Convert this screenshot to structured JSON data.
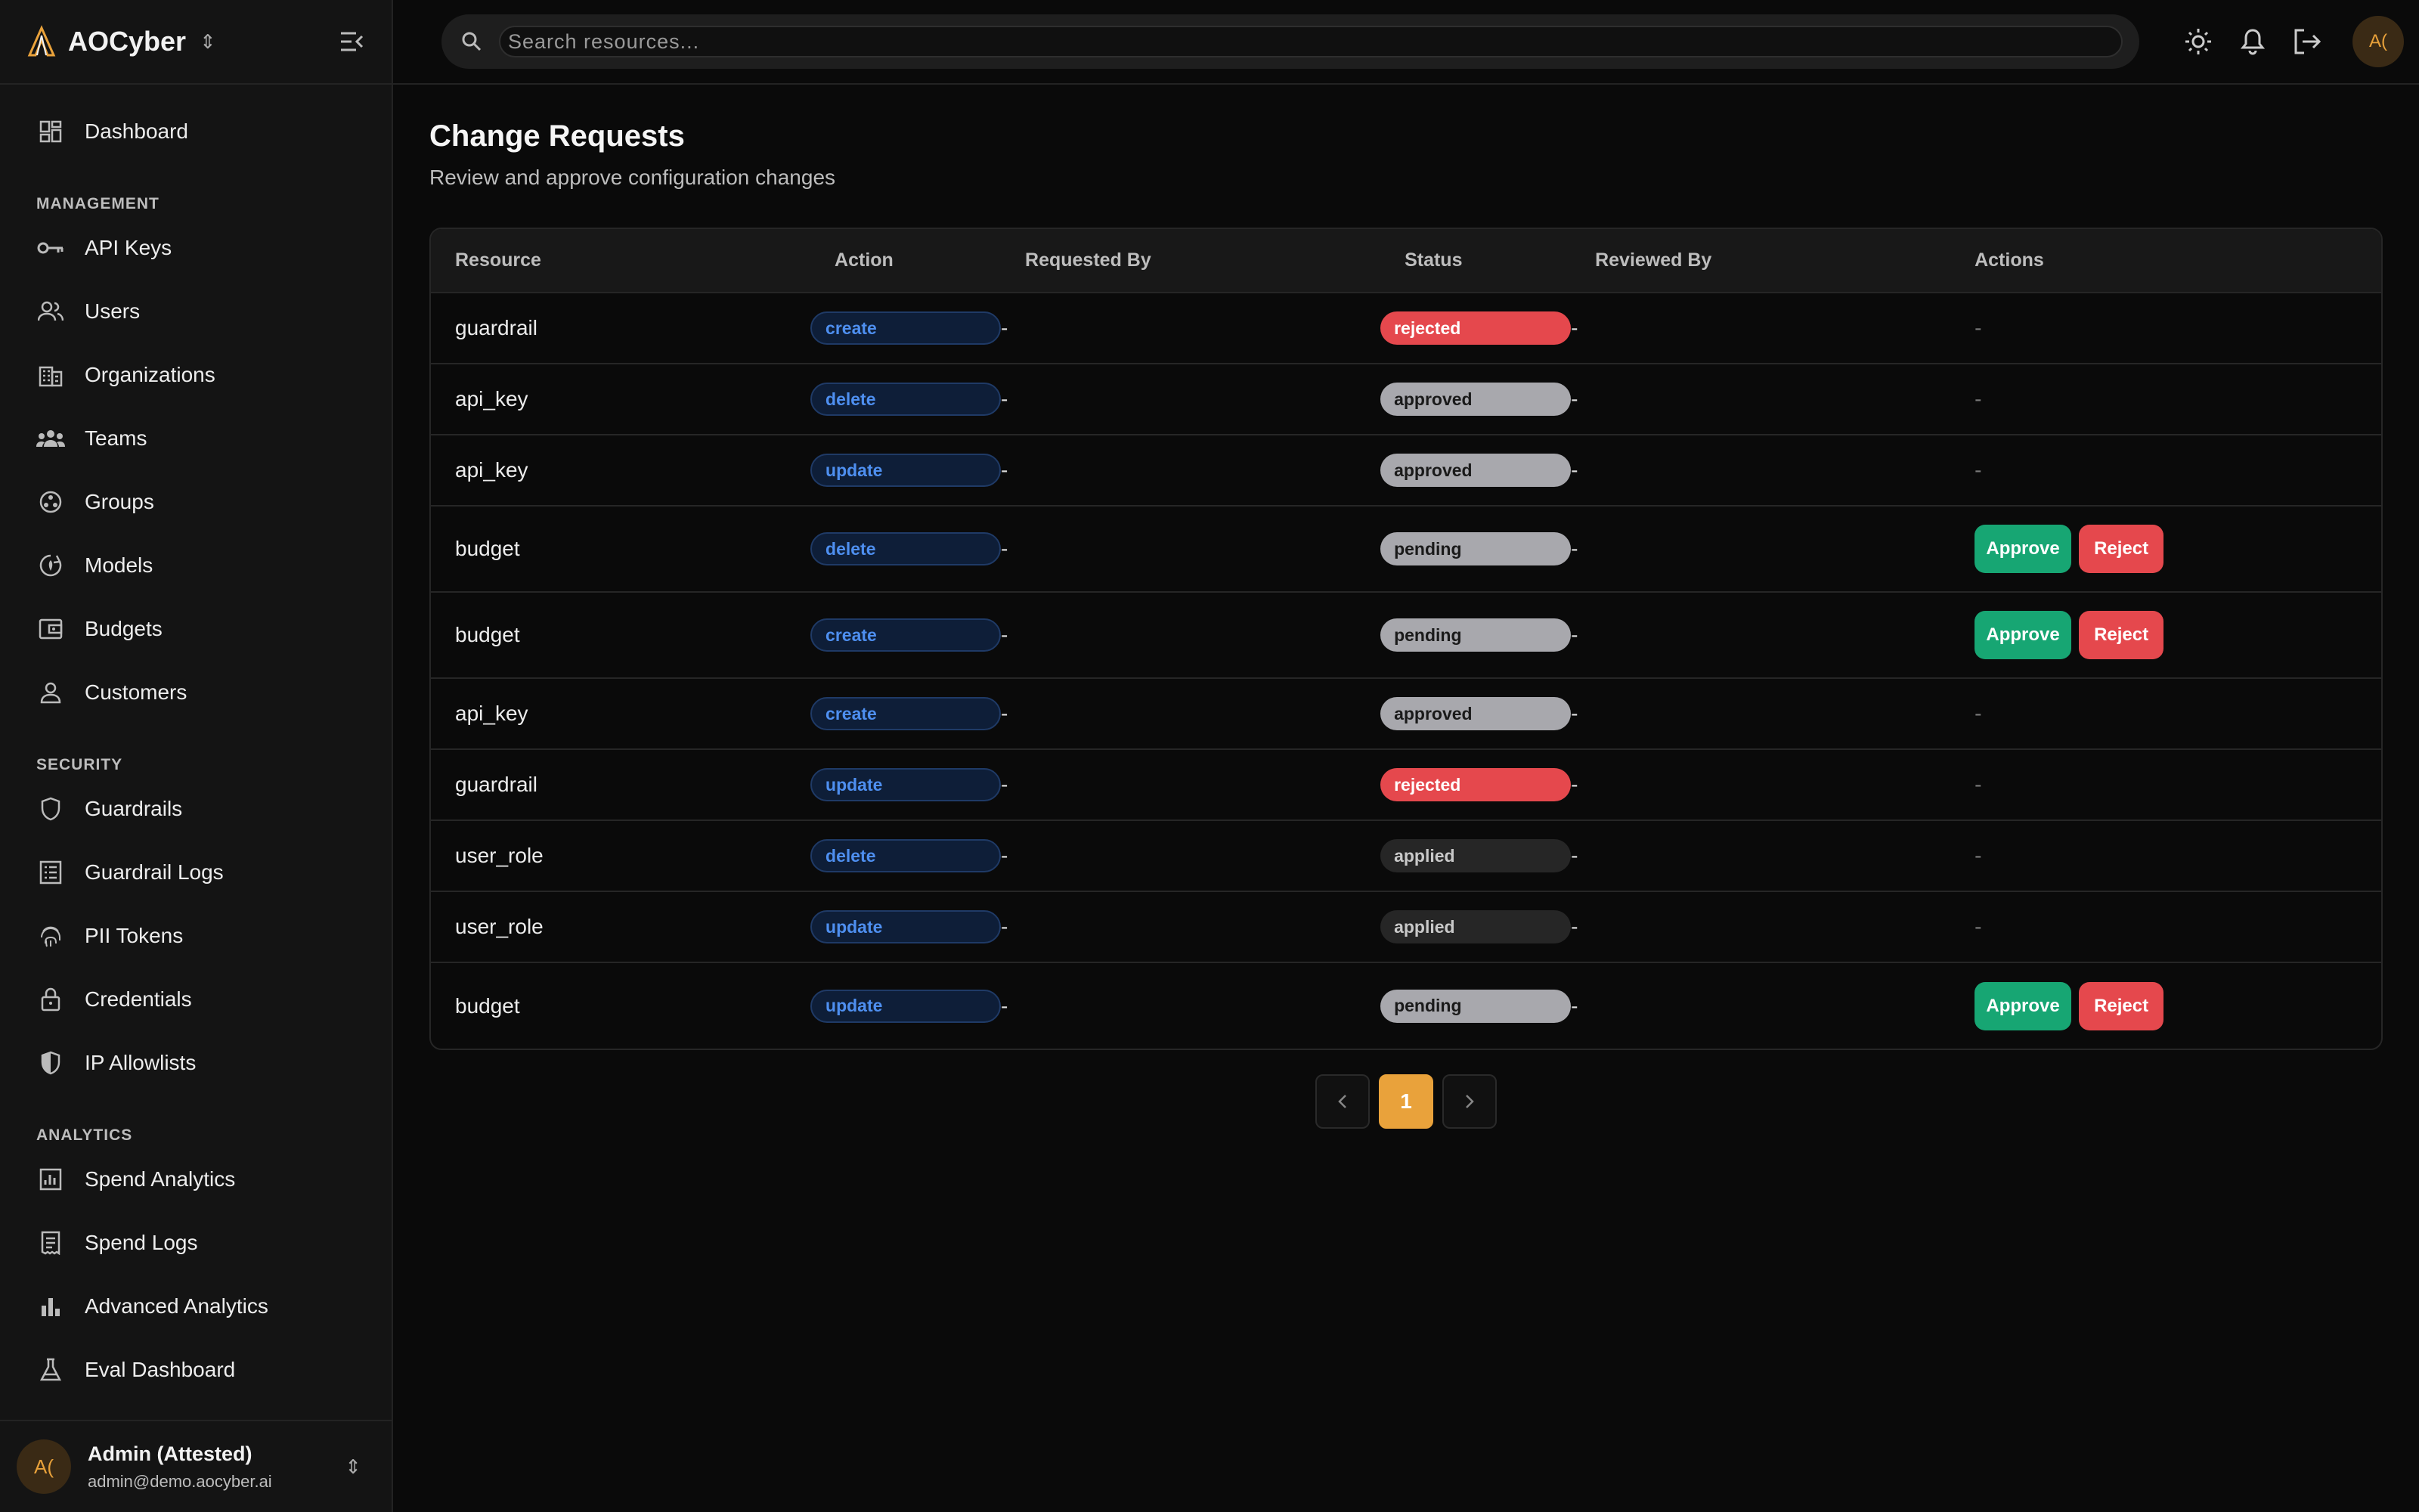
{
  "brand": {
    "name": "AOCyber"
  },
  "search": {
    "placeholder": "Search resources..."
  },
  "header": {
    "avatar_initials": "A("
  },
  "nav": {
    "top": [
      {
        "label": "Dashboard",
        "icon": "dashboard-icon"
      }
    ],
    "sections": [
      {
        "title": "MANAGEMENT",
        "items": [
          {
            "label": "API Keys",
            "icon": "key-icon"
          },
          {
            "label": "Users",
            "icon": "users-icon"
          },
          {
            "label": "Organizations",
            "icon": "building-icon"
          },
          {
            "label": "Teams",
            "icon": "team-icon"
          },
          {
            "label": "Groups",
            "icon": "groups-icon"
          },
          {
            "label": "Models",
            "icon": "model-icon"
          },
          {
            "label": "Budgets",
            "icon": "wallet-icon"
          },
          {
            "label": "Customers",
            "icon": "customer-icon"
          }
        ]
      },
      {
        "title": "SECURITY",
        "items": [
          {
            "label": "Guardrails",
            "icon": "shield-icon"
          },
          {
            "label": "Guardrail Logs",
            "icon": "log-icon"
          },
          {
            "label": "PII Tokens",
            "icon": "fingerprint-icon"
          },
          {
            "label": "Credentials",
            "icon": "lock-icon"
          },
          {
            "label": "IP Allowlists",
            "icon": "shield-half-icon"
          }
        ]
      },
      {
        "title": "ANALYTICS",
        "items": [
          {
            "label": "Spend Analytics",
            "icon": "chart-icon"
          },
          {
            "label": "Spend Logs",
            "icon": "receipt-icon"
          },
          {
            "label": "Advanced Analytics",
            "icon": "bar-chart-icon"
          },
          {
            "label": "Eval Dashboard",
            "icon": "flask-icon"
          }
        ]
      }
    ]
  },
  "user": {
    "initials": "A(",
    "name": "Admin (Attested)",
    "email": "admin@demo.aocyber.ai"
  },
  "page": {
    "title": "Change Requests",
    "subtitle": "Review and approve configuration changes"
  },
  "table": {
    "columns": [
      "Resource",
      "Action",
      "Requested By",
      "Status",
      "Reviewed By",
      "Actions"
    ],
    "rows": [
      {
        "resource": "guardrail",
        "action": "create",
        "requested_by": "-",
        "status": "rejected",
        "reviewed_by": "-",
        "actions": "-"
      },
      {
        "resource": "api_key",
        "action": "delete",
        "requested_by": "-",
        "status": "approved",
        "reviewed_by": "-",
        "actions": "-"
      },
      {
        "resource": "api_key",
        "action": "update",
        "requested_by": "-",
        "status": "approved",
        "reviewed_by": "-",
        "actions": "-"
      },
      {
        "resource": "budget",
        "action": "delete",
        "requested_by": "-",
        "status": "pending",
        "reviewed_by": "-",
        "actions": "buttons"
      },
      {
        "resource": "budget",
        "action": "create",
        "requested_by": "-",
        "status": "pending",
        "reviewed_by": "-",
        "actions": "buttons"
      },
      {
        "resource": "api_key",
        "action": "create",
        "requested_by": "-",
        "status": "approved",
        "reviewed_by": "-",
        "actions": "-"
      },
      {
        "resource": "guardrail",
        "action": "update",
        "requested_by": "-",
        "status": "rejected",
        "reviewed_by": "-",
        "actions": "-"
      },
      {
        "resource": "user_role",
        "action": "delete",
        "requested_by": "-",
        "status": "applied",
        "reviewed_by": "-",
        "actions": "-"
      },
      {
        "resource": "user_role",
        "action": "update",
        "requested_by": "-",
        "status": "applied",
        "reviewed_by": "-",
        "actions": "-"
      },
      {
        "resource": "budget",
        "action": "update",
        "requested_by": "-",
        "status": "pending",
        "reviewed_by": "-",
        "actions": "buttons"
      }
    ],
    "approve_label": "Approve",
    "reject_label": "Reject"
  },
  "pagination": {
    "current_page": "1"
  },
  "colors": {
    "accent": "#e9a23b",
    "approve": "#17a673",
    "reject": "#e5484d",
    "action_text": "#4e8ff0"
  }
}
